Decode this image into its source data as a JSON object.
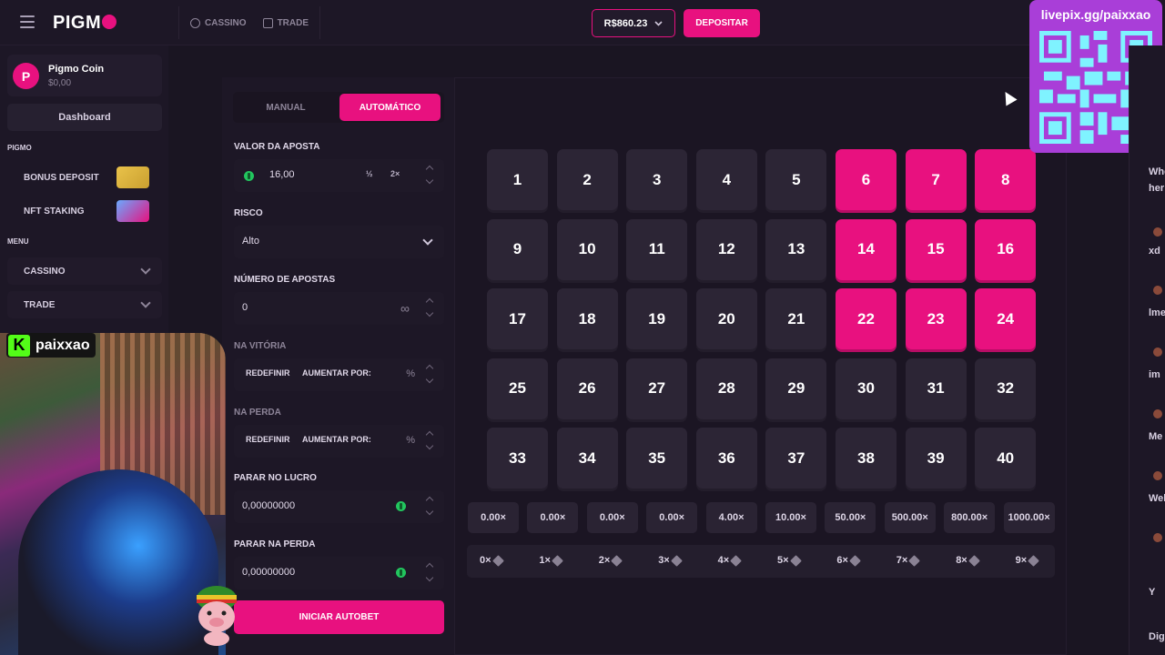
{
  "header": {
    "logo": "PIGM",
    "nav": [
      {
        "label": "CASSINO"
      },
      {
        "label": "TRADE"
      }
    ],
    "balance": "R$860.23",
    "deposit_label": "DEPOSITAR"
  },
  "sidebar": {
    "coin_name": "Pigmo Coin",
    "coin_balance": "$0,00",
    "dashboard_label": "Dashboard",
    "section_pigmo": "PIGMO",
    "bonus_deposit": "BONUS DEPOSIT",
    "nft_staking": "NFT STAKING",
    "section_menu": "MENU",
    "cassino": "CASSINO",
    "trade": "TRADE"
  },
  "stream": {
    "channel": "paixxao"
  },
  "qr": {
    "url": "livepix.gg/paixxao"
  },
  "panel": {
    "tab_manual": "MANUAL",
    "tab_auto": "AUTOMÁTICO",
    "bet_label": "VALOR DA APOSTA",
    "bet_value": "16,00",
    "half": "½",
    "double": "2×",
    "risk_label": "RISCO",
    "risk_value": "Alto",
    "num_bets_label": "NÚMERO DE APOSTAS",
    "num_bets_value": "0",
    "infinite": "∞",
    "on_win_label": "NA VITÓRIA",
    "on_loss_label": "NA PERDA",
    "reset": "REDEFINIR",
    "increase_by": "AUMENTAR POR:",
    "percent": "%",
    "stop_profit_label": "PARAR NO LUCRO",
    "stop_profit_value": "0,00000000",
    "stop_loss_label": "PARAR NA PERDA",
    "stop_loss_value": "0,00000000",
    "autobet_label": "INICIAR AUTOBET"
  },
  "grid": {
    "numbers": [
      "1",
      "2",
      "3",
      "4",
      "5",
      "6",
      "7",
      "8",
      "9",
      "10",
      "11",
      "12",
      "13",
      "14",
      "15",
      "16",
      "17",
      "18",
      "19",
      "20",
      "21",
      "22",
      "23",
      "24",
      "25",
      "26",
      "27",
      "28",
      "29",
      "30",
      "31",
      "32",
      "33",
      "34",
      "35",
      "36",
      "37",
      "38",
      "39",
      "40"
    ],
    "selected": [
      6,
      7,
      8,
      14,
      15,
      16,
      22,
      23,
      24
    ]
  },
  "multipliers": [
    "0.00×",
    "0.00×",
    "0.00×",
    "0.00×",
    "4.00×",
    "10.00×",
    "50.00×",
    "500.00×",
    "800.00×",
    "1000.00×"
  ],
  "hits": [
    "0×",
    "1×",
    "2×",
    "3×",
    "4×",
    "5×",
    "6×",
    "7×",
    "8×",
    "9×"
  ],
  "chat": [
    "Whe",
    "her",
    "xd",
    "lme",
    "im",
    "Me",
    "Wel",
    "Y",
    "Digi"
  ],
  "colors": {
    "accent": "#e8117f",
    "bg": "#1a1522",
    "tile": "#2c2535",
    "qr": "#a93ed8",
    "kick": "#53fc18"
  }
}
